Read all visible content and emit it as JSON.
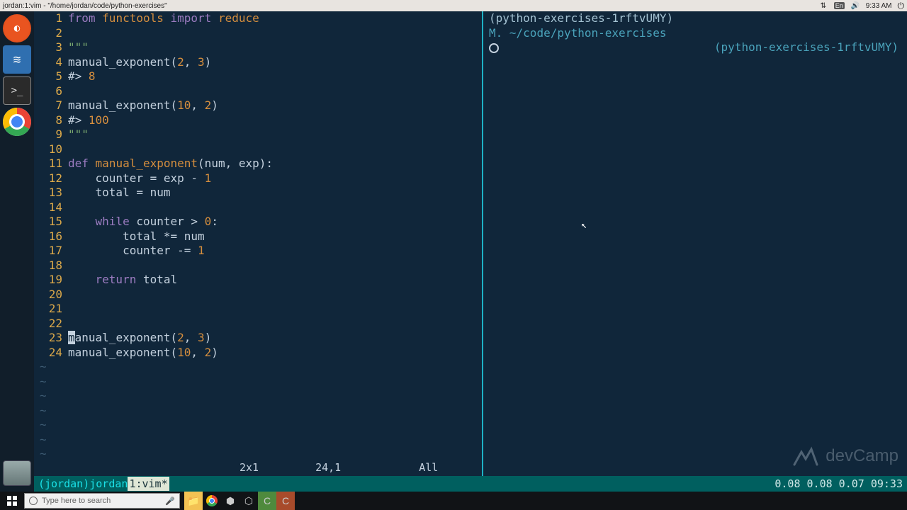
{
  "titlebar": {
    "text": "jordan:1:vim - \"/home/jordan/code/python-exercises\"",
    "tray": {
      "lang": "En",
      "time": "9:33 AM"
    }
  },
  "launcher": {
    "items": [
      "ubuntu",
      "vscode",
      "terminal",
      "chrome"
    ]
  },
  "code": {
    "lines": [
      {
        "n": "1",
        "tokens": [
          [
            "k-from",
            "from"
          ],
          [
            "id",
            " "
          ],
          [
            "fn",
            "functools"
          ],
          [
            "id",
            " "
          ],
          [
            "k-import",
            "import"
          ],
          [
            "id",
            " "
          ],
          [
            "reduce",
            "reduce"
          ]
        ]
      },
      {
        "n": "2",
        "tokens": []
      },
      {
        "n": "3",
        "tokens": [
          [
            "str",
            "\"\"\""
          ]
        ]
      },
      {
        "n": "4",
        "tokens": [
          [
            "id",
            "manual_exponent("
          ],
          [
            "num",
            "2"
          ],
          [
            "id",
            ", "
          ],
          [
            "num",
            "3"
          ],
          [
            "id",
            ")"
          ]
        ]
      },
      {
        "n": "5",
        "tokens": [
          [
            "id",
            "#> "
          ],
          [
            "num",
            "8"
          ]
        ]
      },
      {
        "n": "6",
        "tokens": []
      },
      {
        "n": "7",
        "tokens": [
          [
            "id",
            "manual_exponent("
          ],
          [
            "num",
            "10"
          ],
          [
            "id",
            ", "
          ],
          [
            "num",
            "2"
          ],
          [
            "id",
            ")"
          ]
        ]
      },
      {
        "n": "8",
        "tokens": [
          [
            "id",
            "#> "
          ],
          [
            "num",
            "100"
          ]
        ]
      },
      {
        "n": "9",
        "tokens": [
          [
            "str",
            "\"\"\""
          ]
        ]
      },
      {
        "n": "10",
        "tokens": []
      },
      {
        "n": "11",
        "tokens": [
          [
            "k-def",
            "def"
          ],
          [
            "id",
            " "
          ],
          [
            "fn",
            "manual_exponent"
          ],
          [
            "id",
            "(num, exp):"
          ]
        ]
      },
      {
        "n": "12",
        "tokens": [
          [
            "id",
            "    counter = exp - "
          ],
          [
            "num",
            "1"
          ]
        ]
      },
      {
        "n": "13",
        "tokens": [
          [
            "id",
            "    total = num"
          ]
        ]
      },
      {
        "n": "14",
        "tokens": []
      },
      {
        "n": "15",
        "tokens": [
          [
            "id",
            "    "
          ],
          [
            "k-while",
            "while"
          ],
          [
            "id",
            " counter > "
          ],
          [
            "num",
            "0"
          ],
          [
            "id",
            ":"
          ]
        ]
      },
      {
        "n": "16",
        "tokens": [
          [
            "id",
            "        total *= num"
          ]
        ]
      },
      {
        "n": "17",
        "tokens": [
          [
            "id",
            "        counter -= "
          ],
          [
            "num",
            "1"
          ]
        ]
      },
      {
        "n": "18",
        "tokens": []
      },
      {
        "n": "19",
        "tokens": [
          [
            "id",
            "    "
          ],
          [
            "k-return",
            "return"
          ],
          [
            "id",
            " total"
          ]
        ]
      },
      {
        "n": "20",
        "tokens": []
      },
      {
        "n": "21",
        "tokens": []
      },
      {
        "n": "22",
        "tokens": []
      },
      {
        "n": "23",
        "tokens": [
          [
            "cursor",
            "m"
          ],
          [
            "id",
            "anual_exponent("
          ],
          [
            "num",
            "2"
          ],
          [
            "id",
            ", "
          ],
          [
            "num",
            "3"
          ],
          [
            "id",
            ")"
          ]
        ]
      },
      {
        "n": "24",
        "tokens": [
          [
            "id",
            "manual_exponent("
          ],
          [
            "num",
            "10"
          ],
          [
            "id",
            ", "
          ],
          [
            "num",
            "2"
          ],
          [
            "id",
            ")"
          ]
        ]
      }
    ],
    "tildes": 7
  },
  "vimstatus": {
    "count": "2x1",
    "pos": "24,1",
    "scroll": "All"
  },
  "right": {
    "venv": "(python-exercises-1rftvUMY)",
    "path_prefix": "M.",
    "path": "~/code/python-exercises",
    "venv2": "(python-exercises-1rftvUMY)"
  },
  "statusbar": {
    "left_open": "(",
    "user": "jordan",
    "left_close": ")",
    "space": " ",
    "name2": "jordan",
    "highlight": "1:vim*",
    "right": "0.08 0.08 0.07 09:33"
  },
  "watermark": "devCamp",
  "taskbar": {
    "search_placeholder": "Type here to search"
  }
}
